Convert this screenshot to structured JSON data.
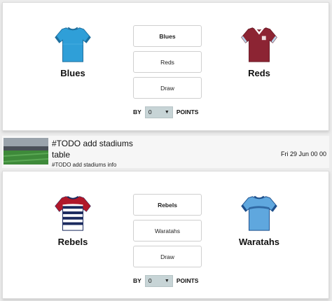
{
  "matches": [
    {
      "home": {
        "name": "Blues",
        "colors": {
          "primary": "#2f9fd8",
          "secondary": "#1e6f9e"
        }
      },
      "away": {
        "name": "Reds",
        "colors": {
          "primary": "#8c2433",
          "secondary": "#6a1a27"
        }
      },
      "options": [
        "Blues",
        "Reds",
        "Draw"
      ],
      "margin": {
        "prefix": "BY",
        "value": "0",
        "suffix": "POINTS"
      }
    },
    {
      "home": {
        "name": "Rebels",
        "colors": {
          "primary": "#ffffff",
          "secondary": "#1a2a5e",
          "stripe": "#b0182a"
        }
      },
      "away": {
        "name": "Waratahs",
        "colors": {
          "primary": "#5fa7de",
          "secondary": "#1d4f8c"
        }
      },
      "options": [
        "Rebels",
        "Waratahs",
        "Draw"
      ],
      "margin": {
        "prefix": "BY",
        "value": "0",
        "suffix": "POINTS"
      }
    }
  ],
  "venue": {
    "title": "#TODO add stadiums",
    "table_label": "table",
    "info": "#TODO add stadiums info",
    "datetime": "Fri 29 Jun 00 00"
  }
}
